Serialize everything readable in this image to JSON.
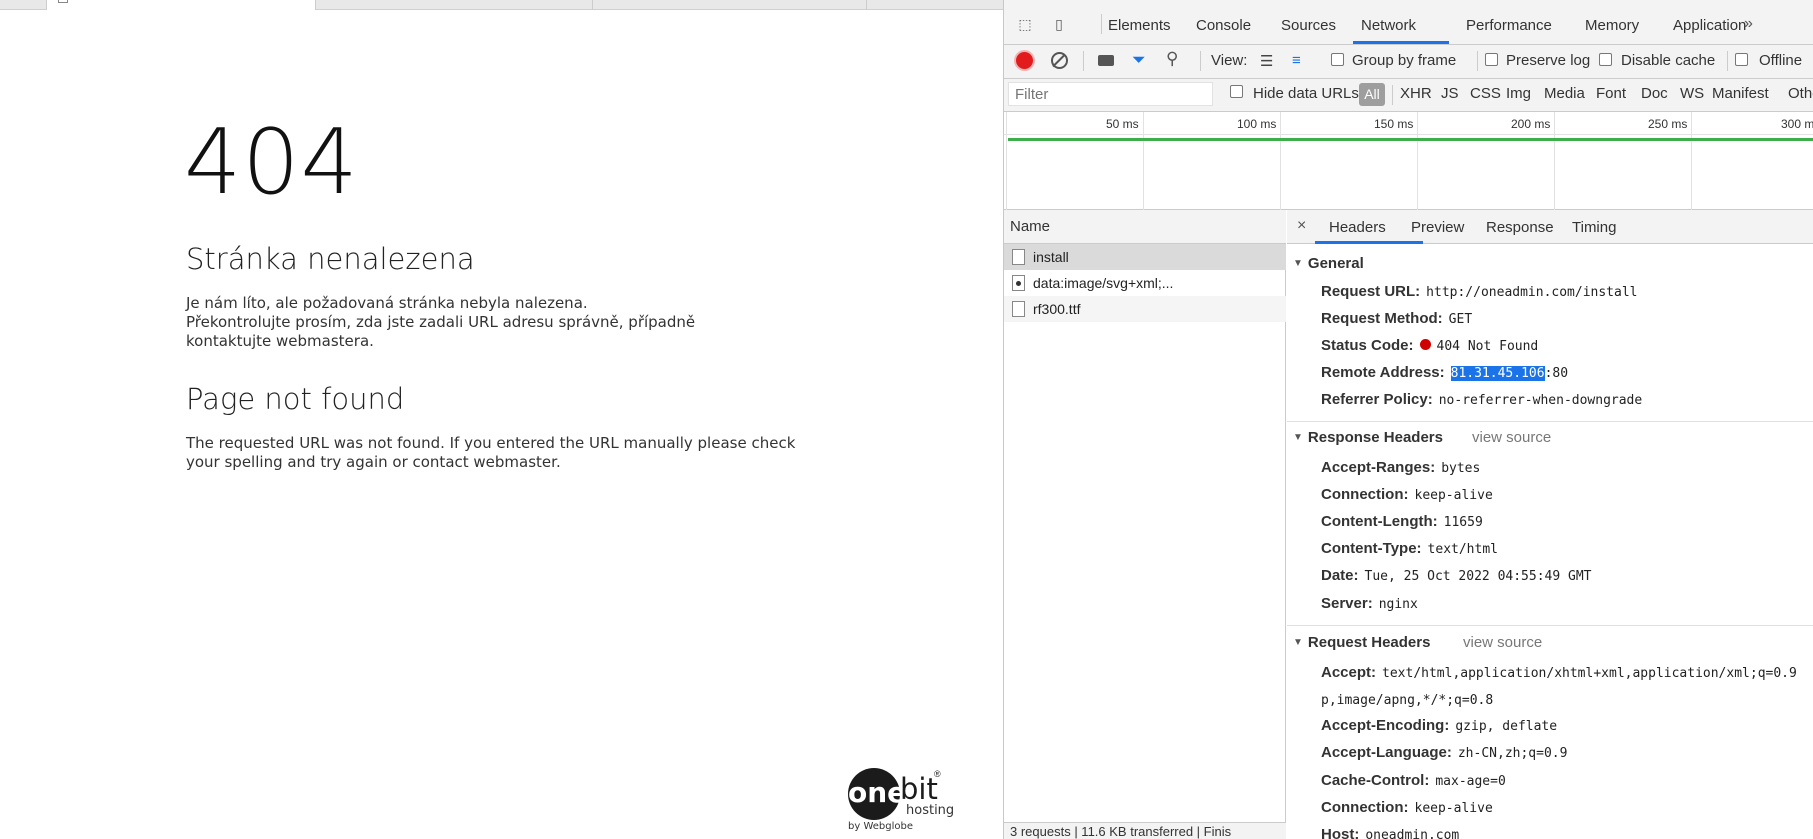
{
  "page": {
    "code": "404",
    "heading_cz": "Stránka nenalezena",
    "text_cz_1": "Je nám líto, ale požadovaná stránka nebyla nalezena.",
    "text_cz_2": "Překontrolujte prosím, zda jste zadali URL adresu správně, případně kontaktujte webmastera.",
    "heading_en": "Page not found",
    "text_en": "The requested URL was not found. If you entered the URL manually please check your spelling and try again or contact webmaster.",
    "logo": {
      "one": "one",
      "bit": "bit",
      "reg": "®",
      "hosting": "hosting",
      "by": "by Webglobe"
    }
  },
  "devtools": {
    "tabs": [
      "Elements",
      "Console",
      "Sources",
      "Network",
      "Performance",
      "Memory",
      "Application"
    ],
    "active_tab": "Network",
    "more": "»",
    "toolbar": {
      "view_label": "View:",
      "group_by_frame": "Group by frame",
      "preserve_log": "Preserve log",
      "disable_cache": "Disable cache",
      "offline": "Offline"
    },
    "filter": {
      "placeholder": "Filter",
      "hide_data_urls": "Hide data URLs",
      "types": [
        "All",
        "XHR",
        "JS",
        "CSS",
        "Img",
        "Media",
        "Font",
        "Doc",
        "WS",
        "Manifest",
        "Othe"
      ]
    },
    "timeline_ticks": [
      "50 ms",
      "100 ms",
      "150 ms",
      "200 ms",
      "250 ms",
      "300 m"
    ],
    "requests": {
      "header": "Name",
      "rows": [
        "install",
        "data:image/svg+xml;...",
        "rf300.ttf"
      ],
      "status": "3 requests | 11.6 KB transferred | Finis"
    },
    "details": {
      "close": "×",
      "tabs": [
        "Headers",
        "Preview",
        "Response",
        "Timing"
      ],
      "general": {
        "title": "General",
        "request_url_key": "Request URL:",
        "request_url": "http://oneadmin.com/install",
        "method_key": "Request Method:",
        "method": "GET",
        "status_key": "Status Code:",
        "status": "404 Not Found",
        "remote_key": "Remote Address:",
        "remote_ip": "81.31.45.106",
        "remote_port": ":80",
        "referrer_key": "Referrer Policy:",
        "referrer": "no-referrer-when-downgrade"
      },
      "response_headers": {
        "title": "Response Headers",
        "view_source": "view source",
        "rows": [
          {
            "k": "Accept-Ranges:",
            "v": "bytes"
          },
          {
            "k": "Connection:",
            "v": "keep-alive"
          },
          {
            "k": "Content-Length:",
            "v": "11659"
          },
          {
            "k": "Content-Type:",
            "v": "text/html"
          },
          {
            "k": "Date:",
            "v": "Tue, 25 Oct 2022 04:55:49 GMT"
          },
          {
            "k": "Server:",
            "v": "nginx"
          }
        ]
      },
      "request_headers": {
        "title": "Request Headers",
        "view_source": "view source",
        "accept_key": "Accept:",
        "accept_1": "text/html,application/xhtml+xml,application/xml;q=0.9",
        "accept_2": "p,image/apng,*/*;q=0.8",
        "rows": [
          {
            "k": "Accept-Encoding:",
            "v": "gzip, deflate"
          },
          {
            "k": "Accept-Language:",
            "v": "zh-CN,zh;q=0.9"
          },
          {
            "k": "Cache-Control:",
            "v": "max-age=0"
          },
          {
            "k": "Connection:",
            "v": "keep-alive"
          },
          {
            "k": "Host:",
            "v": "oneadmin.com"
          }
        ]
      }
    }
  }
}
